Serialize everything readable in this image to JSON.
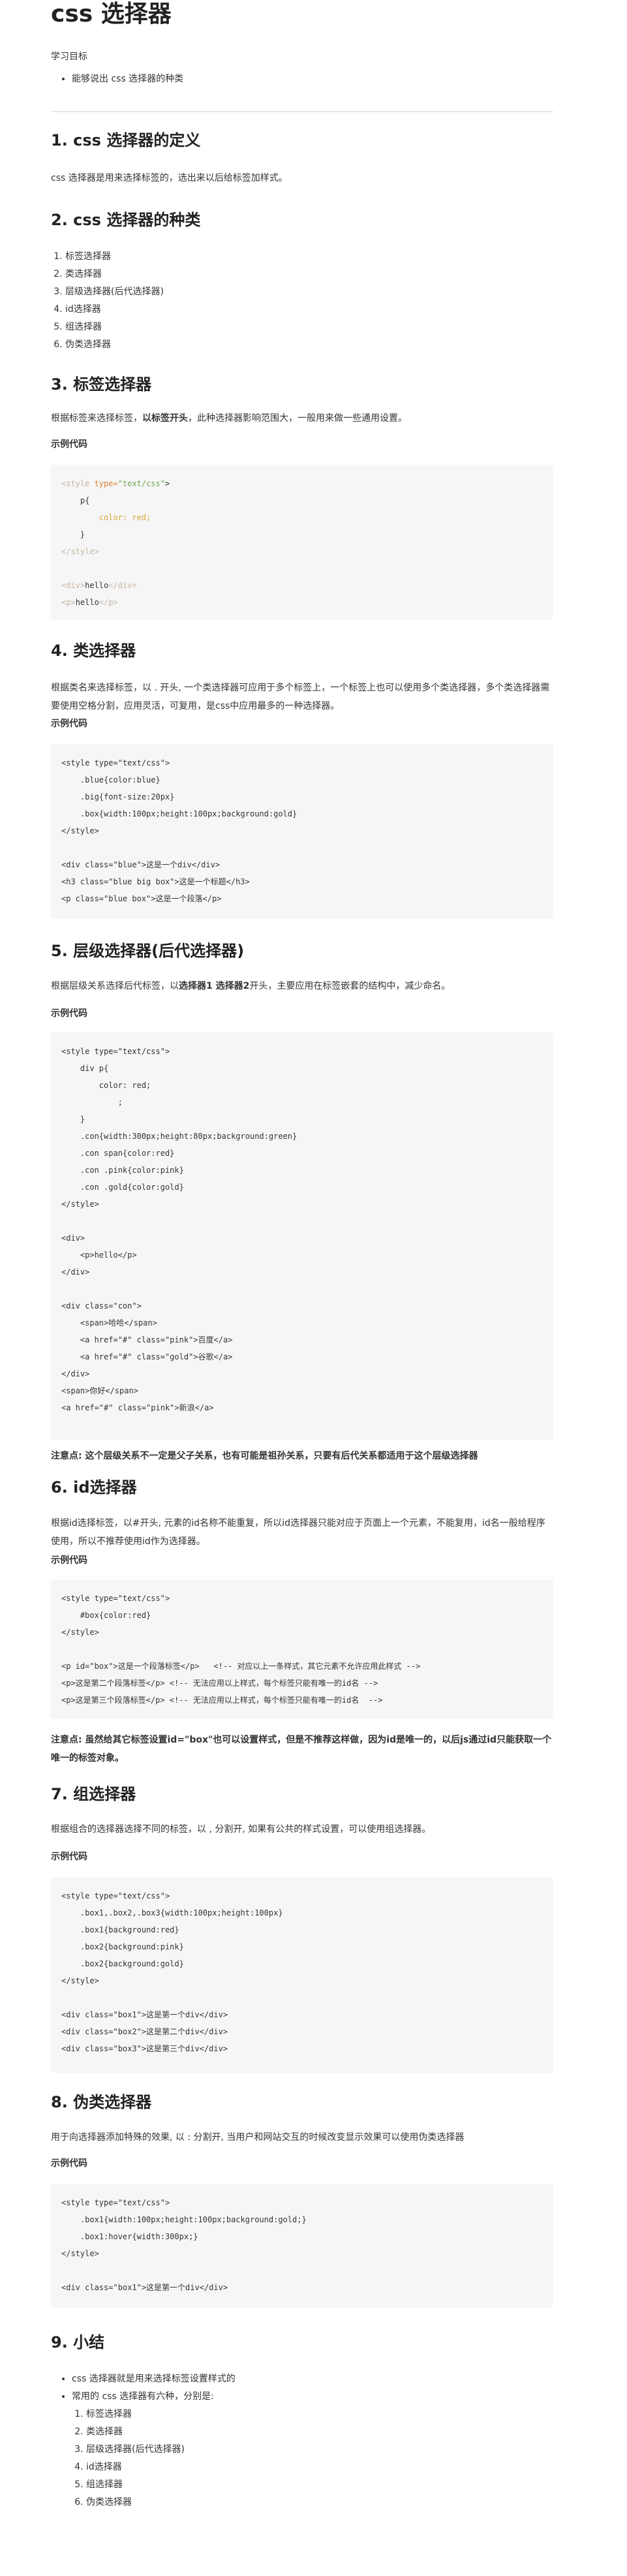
{
  "title": "css 选择器",
  "goal": {
    "label": "学习目标",
    "items": [
      "能够说出 css 选择器的种类"
    ]
  },
  "s1": {
    "heading": "1. css 选择器的定义",
    "text": "css 选择器是用来选择标签的，选出来以后给标签加样式。"
  },
  "s2": {
    "heading": "2. css 选择器的种类",
    "items": [
      "标签选择器",
      "类选择器",
      "层级选择器(后代选择器)",
      "id选择器",
      "组选择器",
      "伪类选择器"
    ]
  },
  "s3": {
    "heading": "3. 标签选择器",
    "text_a": "根据标签来选择标签，",
    "text_b": "以标签开头",
    "text_c": "，此种选择器影响范围大，一般用来做一些通用设置。",
    "code_label": "示例代码",
    "code": [
      {
        "t": "tag",
        "v": "<style "
      },
      {
        "t": "nl"
      }
    ]
  },
  "code_lines": {
    "s3": [
      "<style type=\"text/css\">",
      "    p{",
      "        color: red;",
      "    }",
      "</style>",
      "",
      "<div>hello</div>",
      "<p>hello</p>"
    ],
    "s4": [
      "<style type=\"text/css\">",
      "    .blue{color:blue}",
      "    .big{font-size:20px}",
      "    .box{width:100px;height:100px;background:gold}",
      "</style>",
      "",
      "<div class=\"blue\">这是一个div</div>",
      "<h3 class=\"blue big box\">这是一个标题</h3>",
      "<p class=\"blue box\">这是一个段落</p>"
    ],
    "s5": [
      "<style type=\"text/css\">",
      "    div p{",
      "        color: red;",
      "            ;",
      "    }",
      "    .con{width:300px;height:80px;background:green}",
      "    .con span{color:red}",
      "    .con .pink{color:pink}",
      "    .con .gold{color:gold}",
      "</style>",
      "",
      "<div>",
      "    <p>hello</p>",
      "</div>",
      "",
      "<div class=\"con\">",
      "    <span>哈哈</span>",
      "    <a href=\"#\" class=\"pink\">百度</a>",
      "    <a href=\"#\" class=\"gold\">谷歌</a>",
      "</div>",
      "<span>你好</span>",
      "<a href=\"#\" class=\"pink\">新浪</a>"
    ],
    "s6": [
      "<style type=\"text/css\">",
      "    #box{color:red}",
      "</style>",
      "",
      "<p id=\"box\">这是一个段落标签</p>   <!-- 对应以上一条样式，其它元素不允许应用此样式 -->",
      "<p>这是第二个段落标签</p> <!-- 无法应用以上样式，每个标签只能有唯一的id名 -->",
      "<p>这是第三个段落标签</p> <!-- 无法应用以上样式，每个标签只能有唯一的id名  -->"
    ],
    "s7": [
      "<style type=\"text/css\">",
      "    .box1,.box2,.box3{width:100px;height:100px}",
      "    .box1{background:red}",
      "    .box2{background:pink}",
      "    .box2{background:gold}",
      "</style>",
      "",
      "<div class=\"box1\">这是第一个div</div>",
      "<div class=\"box2\">这是第二个div</div>",
      "<div class=\"box3\">这是第三个div</div>"
    ],
    "s8": [
      "<style type=\"text/css\">",
      "    .box1{width:100px;height:100px;background:gold;}",
      "    .box1:hover{width:300px;}",
      "</style>",
      "",
      "<div class=\"box1\">这是第一个div</div>"
    ]
  },
  "s4": {
    "heading": "4. 类选择器",
    "text": "根据类名来选择标签，以 . 开头, 一个类选择器可应用于多个标签上，一个标签上也可以使用多个类选择器，多个类选择器需要使用空格分割，应用灵活，可复用，是css中应用最多的一种选择器。",
    "code_label": "示例代码"
  },
  "s5": {
    "heading": "5. 层级选择器(后代选择器)",
    "text_a": "根据层级关系选择后代标签，以",
    "text_b": "选择器1 选择器2",
    "text_c": "开头，主要应用在标签嵌套的结构中，减少命名。",
    "code_label": "示例代码",
    "note": "注意点: 这个层级关系不一定是父子关系，也有可能是祖孙关系，只要有后代关系都适用于这个层级选择器"
  },
  "s6": {
    "heading": "6. id选择器",
    "text": "根据id选择标签，以#开头, 元素的id名称不能重复，所以id选择器只能对应于页面上一个元素，不能复用，id名一般给程序使用，所以不推荐使用id作为选择器。",
    "code_label": "示例代码",
    "note_a": "注意点: 虽然给其它标签设置",
    "note_b": "id=\"box\"",
    "note_c": "也可以设置样式，但是不推荐这样做，因为id是唯一的，以后js通过id只能获取一个唯一的标签对象。"
  },
  "s7": {
    "heading": "7. 组选择器",
    "text": "根据组合的选择器选择不同的标签，以 , 分割开, 如果有公共的样式设置，可以使用组选择器。",
    "code_label": "示例代码"
  },
  "s8": {
    "heading": "8. 伪类选择器",
    "text": "用于向选择器添加特殊的效果, 以 : 分割开, 当用户和网站交互的时候改变显示效果可以使用伪类选择器",
    "code_label": "示例代码"
  },
  "s9": {
    "heading": "9. 小结",
    "b1": "css 选择器就是用来选择标签设置样式的",
    "b2": "常用的 css 选择器有六种，分别是:",
    "items": [
      "标签选择器",
      "类选择器",
      "层级选择器(后代选择器)",
      "id选择器",
      "组选择器",
      "伪类选择器"
    ]
  }
}
